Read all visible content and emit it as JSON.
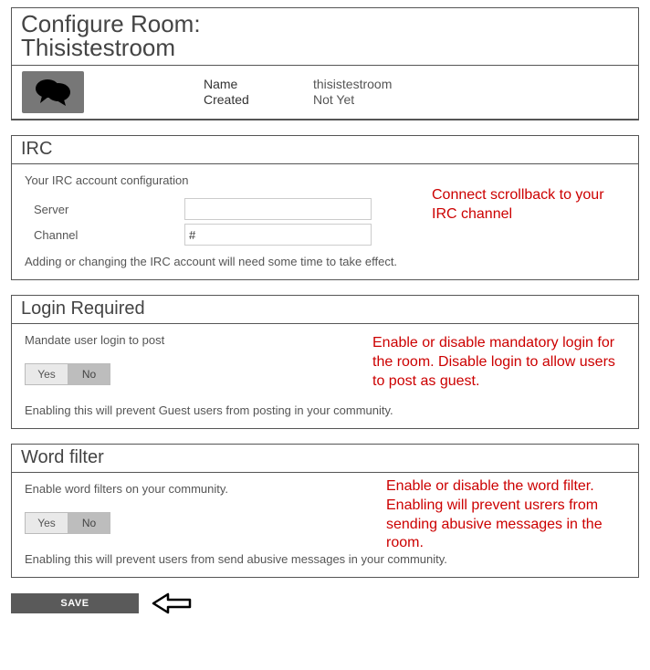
{
  "header": {
    "title_prefix": "Configure Room:",
    "room_name": "Thisistestroom"
  },
  "info": {
    "name_label": "Name",
    "name_value": "thisistestroom",
    "created_label": "Created",
    "created_value": "Not Yet"
  },
  "irc": {
    "title": "IRC",
    "lede": "Your IRC account configuration",
    "server_label": "Server",
    "server_value": "",
    "channel_label": "Channel",
    "channel_value": "#",
    "note": "Adding or changing the IRC account will need some time to take effect.",
    "callout": "Connect scrollback to your IRC channel"
  },
  "login": {
    "title": "Login Required",
    "lede": "Mandate user login to post",
    "yes": "Yes",
    "no": "No",
    "note": "Enabling this will prevent Guest users from posting in your community.",
    "callout": "Enable or disable mandatory login for the room. Disable login to allow users to post as guest."
  },
  "wordfilter": {
    "title": "Word filter",
    "lede": "Enable word filters on your community.",
    "yes": "Yes",
    "no": "No",
    "note": "Enabling this will prevent users from send abusive messages in your community.",
    "callout": "Enable or disable the word filter. Enabling will prevent usrers from sending abusive messages in the room."
  },
  "save": {
    "label": "SAVE"
  },
  "icons": {
    "chat": "chat-bubbles-icon",
    "arrow": "arrow-left-icon"
  }
}
